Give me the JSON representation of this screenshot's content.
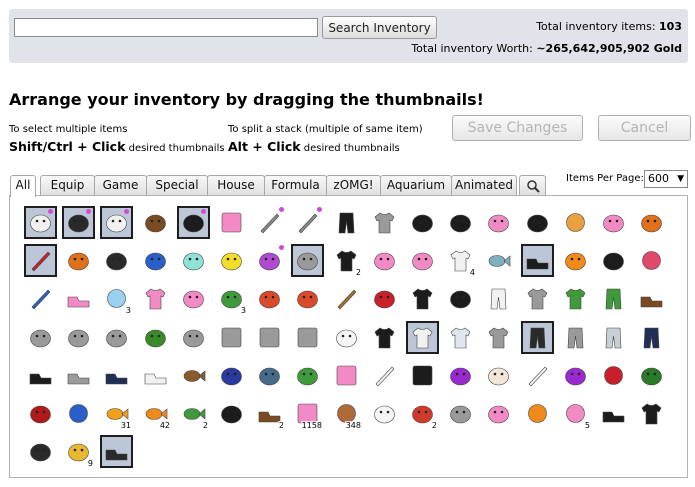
{
  "search": {
    "placeholder": "",
    "button_label": "Search Inventory"
  },
  "totals": {
    "items_label": "Total inventory items:",
    "items_value": "103",
    "worth_label": "Total inventory Worth:",
    "worth_value": "~265,642,905,902 Gold"
  },
  "heading": "Arrange your inventory by dragging the thumbnails!",
  "hints": {
    "multi_small": "To select multiple items",
    "multi_keys": "Shift/Ctrl + Click",
    "multi_rest": "desired thumbnails",
    "split_small": "To split a stack (multiple of same item)",
    "split_keys": "Alt + Click",
    "split_rest": "desired thumbnails"
  },
  "buttons": {
    "save": "Save Changes",
    "cancel": "Cancel"
  },
  "tabs": [
    "All",
    "Equip",
    "Game",
    "Special",
    "House",
    "Formula",
    "zOMG!",
    "Aquarium",
    "Animated"
  ],
  "active_tab": "All",
  "items_per_page": {
    "label": "Items Per Page:",
    "value": "600"
  },
  "colors": {
    "topbar_bg": "#e1e3ea",
    "selected_bg": "#bcc6d6",
    "rarity_dot": "#d14bd6"
  },
  "inventory": [
    {
      "icon": "white-cat-plush",
      "count": "",
      "sel": true,
      "rare": true
    },
    {
      "icon": "dark-blaster",
      "count": "",
      "sel": true,
      "rare": true
    },
    {
      "icon": "white-drone",
      "count": "",
      "sel": true,
      "rare": true
    },
    {
      "icon": "brown-hair-face",
      "count": "",
      "sel": false,
      "rare": false
    },
    {
      "icon": "black-bear",
      "count": "",
      "sel": true,
      "rare": true
    },
    {
      "icon": "pink-stamp",
      "count": "",
      "sel": false,
      "rare": false
    },
    {
      "icon": "dagger",
      "count": "",
      "sel": false,
      "rare": true
    },
    {
      "icon": "blade",
      "count": "",
      "sel": false,
      "rare": true
    },
    {
      "icon": "black-pants",
      "count": "",
      "sel": false,
      "rare": false
    },
    {
      "icon": "grey-shirt",
      "count": "",
      "sel": false,
      "rare": false
    },
    {
      "icon": "black-tie",
      "count": "",
      "sel": false,
      "rare": false
    },
    {
      "icon": "black-bat",
      "count": "",
      "sel": false,
      "rare": false
    },
    {
      "icon": "pink-bow",
      "count": "",
      "sel": false,
      "rare": false
    },
    {
      "icon": "black-sunglasses",
      "count": "",
      "sel": false,
      "rare": false
    },
    {
      "icon": "tiny-orange-dot",
      "count": "",
      "sel": false,
      "rare": false
    },
    {
      "icon": "pink-lips",
      "count": "",
      "sel": false,
      "rare": false
    },
    {
      "icon": "jack-o-lantern",
      "count": "",
      "sel": false,
      "rare": false
    },
    {
      "icon": "red-feather",
      "count": "",
      "sel": true,
      "rare": false
    },
    {
      "icon": "pumpkin",
      "count": "",
      "sel": false,
      "rare": false
    },
    {
      "icon": "dark-glasses",
      "count": "",
      "sel": false,
      "rare": false
    },
    {
      "icon": "blue-cap",
      "count": "",
      "sel": false,
      "rare": false
    },
    {
      "icon": "cyan-bunny",
      "count": "",
      "sel": false,
      "rare": false
    },
    {
      "icon": "yellow-chick",
      "count": "",
      "sel": false,
      "rare": false
    },
    {
      "icon": "party-hat",
      "count": "",
      "sel": false,
      "rare": true
    },
    {
      "icon": "grey-whiskers",
      "count": "",
      "sel": true,
      "rare": false
    },
    {
      "icon": "black-tshirt",
      "count": "2",
      "sel": false,
      "rare": false
    },
    {
      "icon": "pink-skull",
      "count": "",
      "sel": false,
      "rare": false
    },
    {
      "icon": "pink-pig",
      "count": "",
      "sel": false,
      "rare": false
    },
    {
      "icon": "white-tshirt",
      "count": "4",
      "sel": false,
      "rare": false
    },
    {
      "icon": "small-fish",
      "count": "",
      "sel": false,
      "rare": false
    },
    {
      "icon": "black-shoes",
      "count": "",
      "sel": true,
      "rare": false
    },
    {
      "icon": "orange-eyes",
      "count": "",
      "sel": false,
      "rare": false
    },
    {
      "icon": "black-collar",
      "count": "",
      "sel": false,
      "rare": false
    },
    {
      "icon": "patriot-ball",
      "count": "",
      "sel": false,
      "rare": false
    },
    {
      "icon": "blue-feather",
      "count": "",
      "sel": false,
      "rare": false
    },
    {
      "icon": "pink-slippers",
      "count": "",
      "sel": false,
      "rare": false
    },
    {
      "icon": "egg-basket",
      "count": "3",
      "sel": false,
      "rare": false
    },
    {
      "icon": "pink-shirt",
      "count": "",
      "sel": false,
      "rare": false
    },
    {
      "icon": "pink-bunny-ears",
      "count": "",
      "sel": false,
      "rare": false
    },
    {
      "icon": "green-potion",
      "count": "3",
      "sel": false,
      "rare": false
    },
    {
      "icon": "no-sign-brown",
      "count": "",
      "sel": false,
      "rare": false
    },
    {
      "icon": "no-sign-red",
      "count": "",
      "sel": false,
      "rare": false
    },
    {
      "icon": "butterfly-net",
      "count": "",
      "sel": false,
      "rare": false
    },
    {
      "icon": "red-bottle",
      "count": "",
      "sel": false,
      "rare": false
    },
    {
      "icon": "black-bear-hood",
      "count": "",
      "sel": false,
      "rare": false
    },
    {
      "icon": "black-skirt",
      "count": "",
      "sel": false,
      "rare": false
    },
    {
      "icon": "white-stockings",
      "count": "",
      "sel": false,
      "rare": false
    },
    {
      "icon": "grey-dress",
      "count": "",
      "sel": false,
      "rare": false
    },
    {
      "icon": "green-shirt",
      "count": "",
      "sel": false,
      "rare": false
    },
    {
      "icon": "green-shorts",
      "count": "",
      "sel": false,
      "rare": false
    },
    {
      "icon": "brown-sandals",
      "count": "",
      "sel": false,
      "rare": false
    },
    {
      "icon": "grey-table",
      "count": "",
      "sel": false,
      "rare": false
    },
    {
      "icon": "grey-sofa",
      "count": "",
      "sel": false,
      "rare": false
    },
    {
      "icon": "grey-armchair",
      "count": "",
      "sel": false,
      "rare": false
    },
    {
      "icon": "potted-plant",
      "count": "",
      "sel": false,
      "rare": false
    },
    {
      "icon": "grey-lamp",
      "count": "",
      "sel": false,
      "rare": false
    },
    {
      "icon": "grey-rug",
      "count": "",
      "sel": false,
      "rare": false
    },
    {
      "icon": "grey-panel",
      "count": "",
      "sel": false,
      "rare": false
    },
    {
      "icon": "grey-screen",
      "count": "",
      "sel": false,
      "rare": false
    },
    {
      "icon": "open-book",
      "count": "",
      "sel": false,
      "rare": false
    },
    {
      "icon": "black-cat-hood",
      "count": "",
      "sel": false,
      "rare": false
    },
    {
      "icon": "white-shirt",
      "count": "",
      "sel": true,
      "rare": false
    },
    {
      "icon": "raglan-shirt",
      "count": "",
      "sel": false,
      "rare": false
    },
    {
      "icon": "grey-jacket",
      "count": "",
      "sel": false,
      "rare": false
    },
    {
      "icon": "dark-jeans",
      "count": "",
      "sel": true,
      "rare": false
    },
    {
      "icon": "grey-shorts",
      "count": "",
      "sel": false,
      "rare": false
    },
    {
      "icon": "light-shorts",
      "count": "",
      "sel": false,
      "rare": false
    },
    {
      "icon": "navy-pants",
      "count": "",
      "sel": false,
      "rare": false
    },
    {
      "icon": "black-sneakers",
      "count": "",
      "sel": false,
      "rare": false
    },
    {
      "icon": "grey-sneakers",
      "count": "",
      "sel": false,
      "rare": false
    },
    {
      "icon": "navy-sneakers",
      "count": "",
      "sel": false,
      "rare": false
    },
    {
      "icon": "white-sneakers",
      "count": "",
      "sel": false,
      "rare": false
    },
    {
      "icon": "fishing-rod",
      "count": "",
      "sel": false,
      "rare": false
    },
    {
      "icon": "energy-can",
      "count": "",
      "sel": false,
      "rare": false
    },
    {
      "icon": "shark-fin",
      "count": "",
      "sel": false,
      "rare": false
    },
    {
      "icon": "green-drink-can",
      "count": "",
      "sel": false,
      "rare": false
    },
    {
      "icon": "pink-square",
      "count": "",
      "sel": false,
      "rare": false
    },
    {
      "icon": "white-wing",
      "count": "",
      "sel": false,
      "rare": false
    },
    {
      "icon": "black-square",
      "count": "",
      "sel": false,
      "rare": false
    },
    {
      "icon": "purple-glow",
      "count": "",
      "sel": false,
      "rare": false
    },
    {
      "icon": "bunny-mask",
      "count": "",
      "sel": false,
      "rare": false
    },
    {
      "icon": "white-wing-2",
      "count": "",
      "sel": false,
      "rare": false
    },
    {
      "icon": "purple-spider",
      "count": "",
      "sel": false,
      "rare": false
    },
    {
      "icon": "red-balloon",
      "count": "",
      "sel": false,
      "rare": false
    },
    {
      "icon": "holly-sprig",
      "count": "",
      "sel": false,
      "rare": false
    },
    {
      "icon": "chainsaw",
      "count": "",
      "sel": false,
      "rare": false
    },
    {
      "icon": "blue-egg",
      "count": "",
      "sel": false,
      "rare": false
    },
    {
      "icon": "goldfish",
      "count": "31",
      "sel": false,
      "rare": false
    },
    {
      "icon": "orange-fish",
      "count": "42",
      "sel": false,
      "rare": false
    },
    {
      "icon": "green-fish",
      "count": "2",
      "sel": false,
      "rare": false
    },
    {
      "icon": "black-tire",
      "count": "",
      "sel": false,
      "rare": false
    },
    {
      "icon": "brown-boot",
      "count": "2",
      "sel": false,
      "rare": false
    },
    {
      "icon": "pink-gift",
      "count": "1158",
      "sel": false,
      "rare": false
    },
    {
      "icon": "bronze-coin",
      "count": "348",
      "sel": false,
      "rare": false
    },
    {
      "icon": "daisy",
      "count": "",
      "sel": false,
      "rare": false
    },
    {
      "icon": "snack-bag",
      "count": "2",
      "sel": false,
      "rare": false
    },
    {
      "icon": "grey-rubble",
      "count": "",
      "sel": false,
      "rare": false
    },
    {
      "icon": "pink-tulip",
      "count": "",
      "sel": false,
      "rare": false
    },
    {
      "icon": "orange-candy",
      "count": "",
      "sel": false,
      "rare": false
    },
    {
      "icon": "pink-orb",
      "count": "5",
      "sel": false,
      "rare": false
    },
    {
      "icon": "black-boots",
      "count": "",
      "sel": false,
      "rare": false
    },
    {
      "icon": "black-cape",
      "count": "",
      "sel": false,
      "rare": false
    },
    {
      "icon": "police-cap",
      "count": "",
      "sel": false,
      "rare": false
    },
    {
      "icon": "golden-key",
      "count": "9",
      "sel": false,
      "rare": false
    },
    {
      "icon": "dark-boots",
      "count": "",
      "sel": true,
      "rare": false
    }
  ]
}
